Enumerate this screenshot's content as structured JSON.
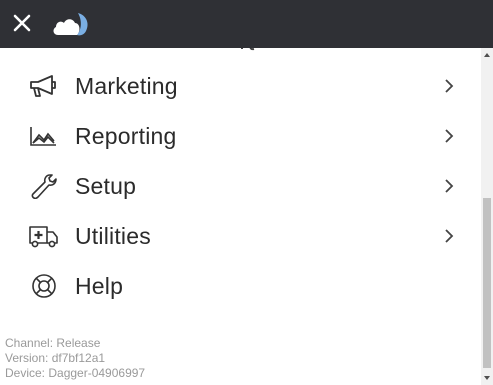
{
  "header": {
    "close_icon": "close-icon",
    "logo_icon": "cloud-logo-icon",
    "background": "#2f3035"
  },
  "menu": {
    "items": [
      {
        "label": "Marketing",
        "icon": "megaphone-icon",
        "has_chevron": true
      },
      {
        "label": "Reporting",
        "icon": "area-chart-icon",
        "has_chevron": true
      },
      {
        "label": "Setup",
        "icon": "wrench-icon",
        "has_chevron": true
      },
      {
        "label": "Utilities",
        "icon": "ambulance-icon",
        "has_chevron": true
      },
      {
        "label": "Help",
        "icon": "lifebuoy-icon",
        "has_chevron": false
      }
    ]
  },
  "footer": {
    "channel": "Channel: Release",
    "version": "Version: df7bf12a1",
    "device": "Device: Dagger-04906997"
  }
}
